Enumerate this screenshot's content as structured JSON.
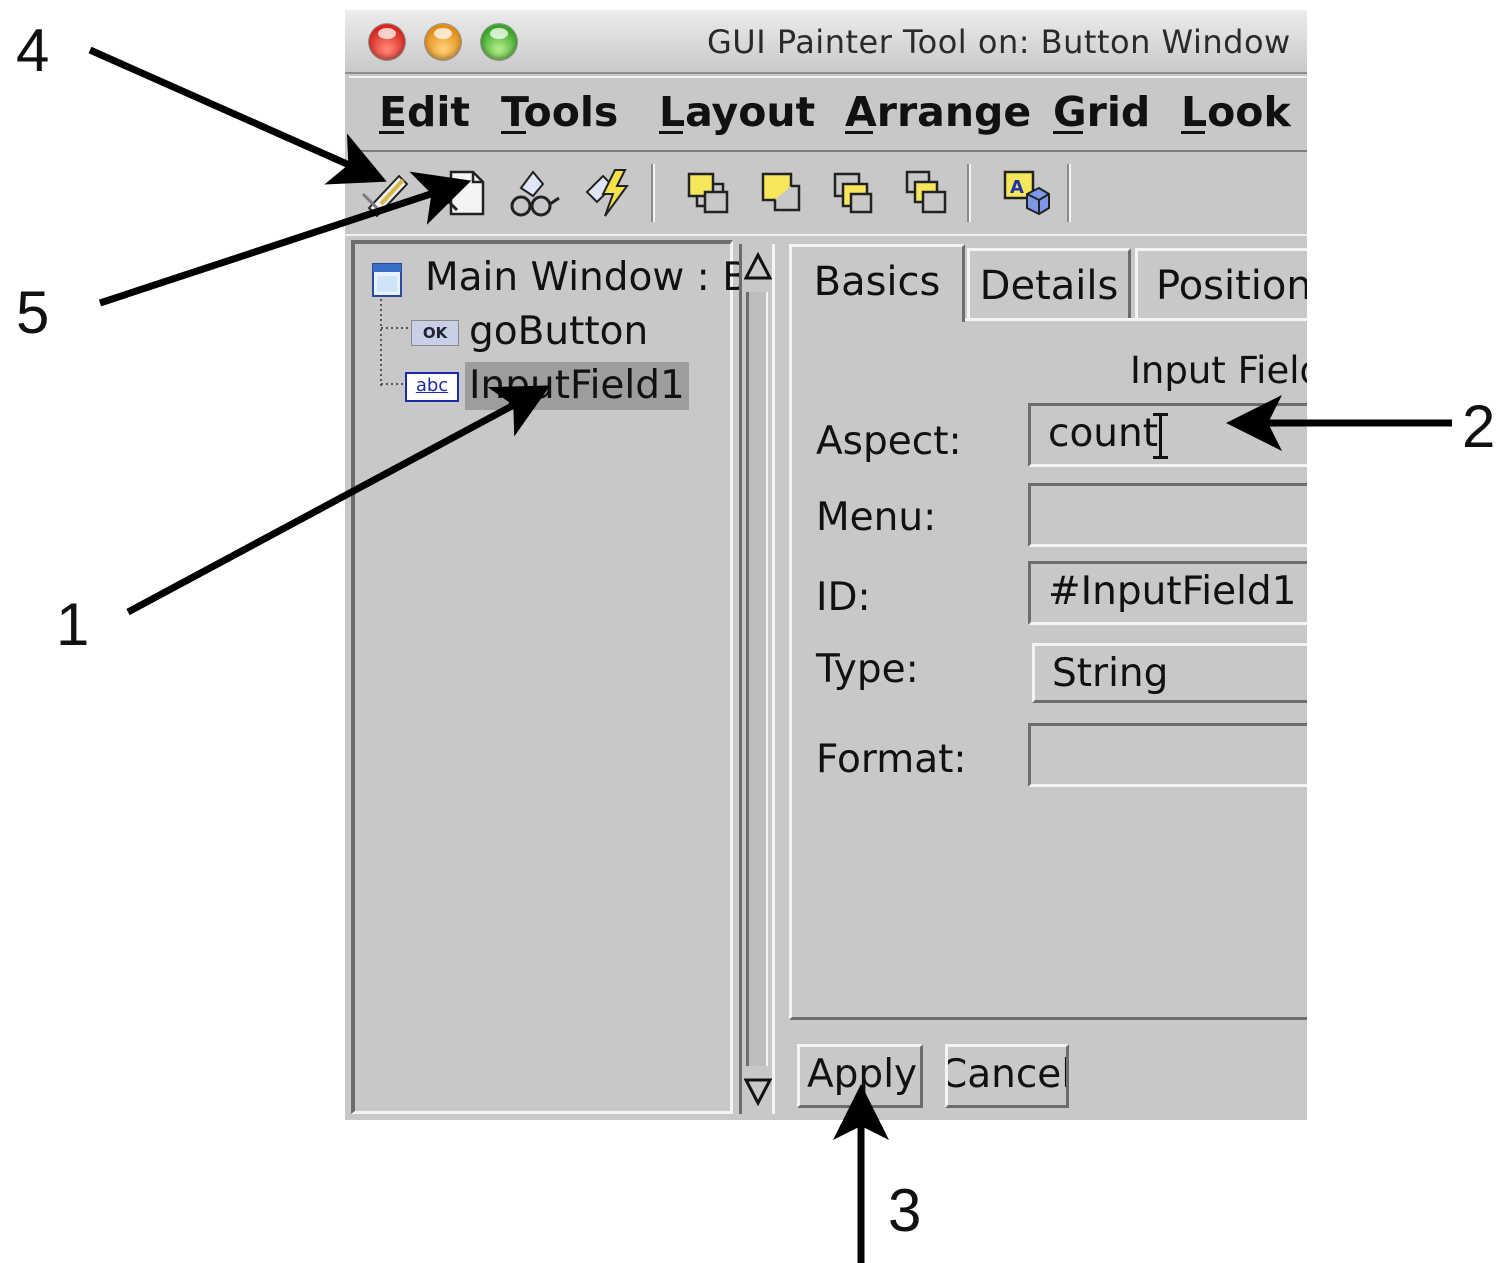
{
  "window": {
    "title": "GUI Painter Tool on: Button Window",
    "traffic_lights": [
      "close",
      "minimize",
      "zoom"
    ]
  },
  "menu": {
    "items": [
      {
        "label": "Edit",
        "mnemonic": "E"
      },
      {
        "label": "Tools",
        "mnemonic": "T"
      },
      {
        "label": "Layout",
        "mnemonic": "L"
      },
      {
        "label": "Arrange",
        "mnemonic": "A"
      },
      {
        "label": "Grid",
        "mnemonic": "G"
      },
      {
        "label": "Look",
        "mnemonic": "L"
      }
    ]
  },
  "toolbar": {
    "icons": [
      "install-icon",
      "new-definition-icon",
      "browse-icon",
      "define-icon",
      "bring-to-front-icon",
      "send-to-back-icon",
      "bring-forward-icon",
      "send-backward-icon",
      "resources-icon"
    ]
  },
  "tree": {
    "items": [
      {
        "label": "Main Window : B",
        "icon": "window-icon"
      },
      {
        "label": "goButton",
        "icon": "ok-button-icon",
        "badge": "OK"
      },
      {
        "label": "InputField1",
        "icon": "input-field-icon",
        "badge": "abc",
        "selected": true
      }
    ]
  },
  "tabs": [
    {
      "label": "Basics",
      "active": true
    },
    {
      "label": "Details"
    },
    {
      "label": "Position"
    }
  ],
  "form": {
    "section_title": "Input Field",
    "aspect_label": "Aspect:",
    "aspect_value": "count",
    "menu_label": "Menu:",
    "menu_value": "",
    "id_label": "ID:",
    "id_value": "#InputField1",
    "type_label": "Type:",
    "type_value": "String",
    "format_label": "Format:",
    "format_value": ""
  },
  "buttons": {
    "apply": "Apply",
    "cancel": "Cancel"
  },
  "annotations": [
    "1",
    "2",
    "3",
    "4",
    "5"
  ],
  "colors": {
    "panel_bg": "#c8c8c8",
    "selection_bg": "#9d9d9d",
    "arrow": "#000000"
  }
}
